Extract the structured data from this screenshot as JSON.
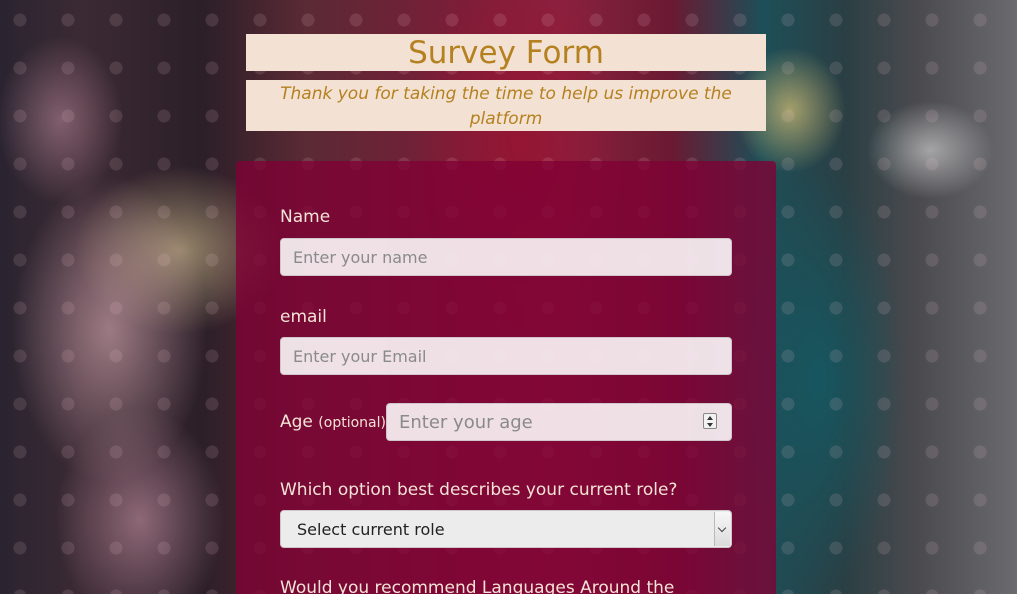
{
  "header": {
    "title": "Survey Form",
    "description": "Thank you for taking the time to help us improve the platform"
  },
  "form": {
    "name": {
      "label": "Name",
      "placeholder": "Enter your name"
    },
    "email": {
      "label": "email",
      "placeholder": "Enter your Email"
    },
    "age": {
      "label": "Age",
      "optional": "(optional)",
      "placeholder": "Enter your age"
    },
    "role": {
      "label": "Which option best describes your current role?",
      "selected": "Select current role"
    },
    "recommend": {
      "label": "Would you recommend Languages Around the"
    }
  },
  "colors": {
    "header_background": "#f3e2d4",
    "header_text": "#b5801f",
    "form_background": "#800034",
    "form_label": "#f4e3d6"
  }
}
